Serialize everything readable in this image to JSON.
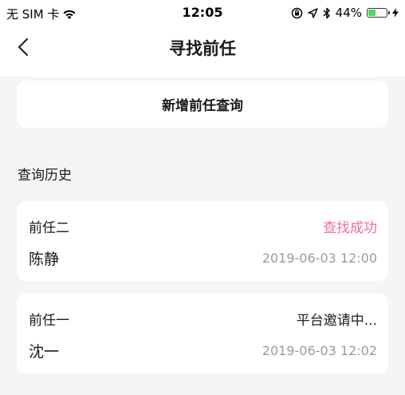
{
  "status_bar": {
    "carrier": "无 SIM 卡",
    "time": "12:05",
    "battery_percent": "44%",
    "battery_level": 0.44,
    "battery_color": "#4cd964"
  },
  "nav": {
    "title": "寻找前任",
    "back_icon": "chevron-left-icon"
  },
  "add_query": {
    "label": "新增前任查询"
  },
  "history": {
    "title": "查询历史",
    "records": [
      {
        "label": "前任二",
        "status": "查找成功",
        "status_color": "#f06f97",
        "name": "陈静",
        "time": "2019-06-03 12:00"
      },
      {
        "label": "前任一",
        "status": "平台邀请中...",
        "status_color": "#222222",
        "name": "沈一",
        "time": "2019-06-03 12:02"
      }
    ]
  }
}
